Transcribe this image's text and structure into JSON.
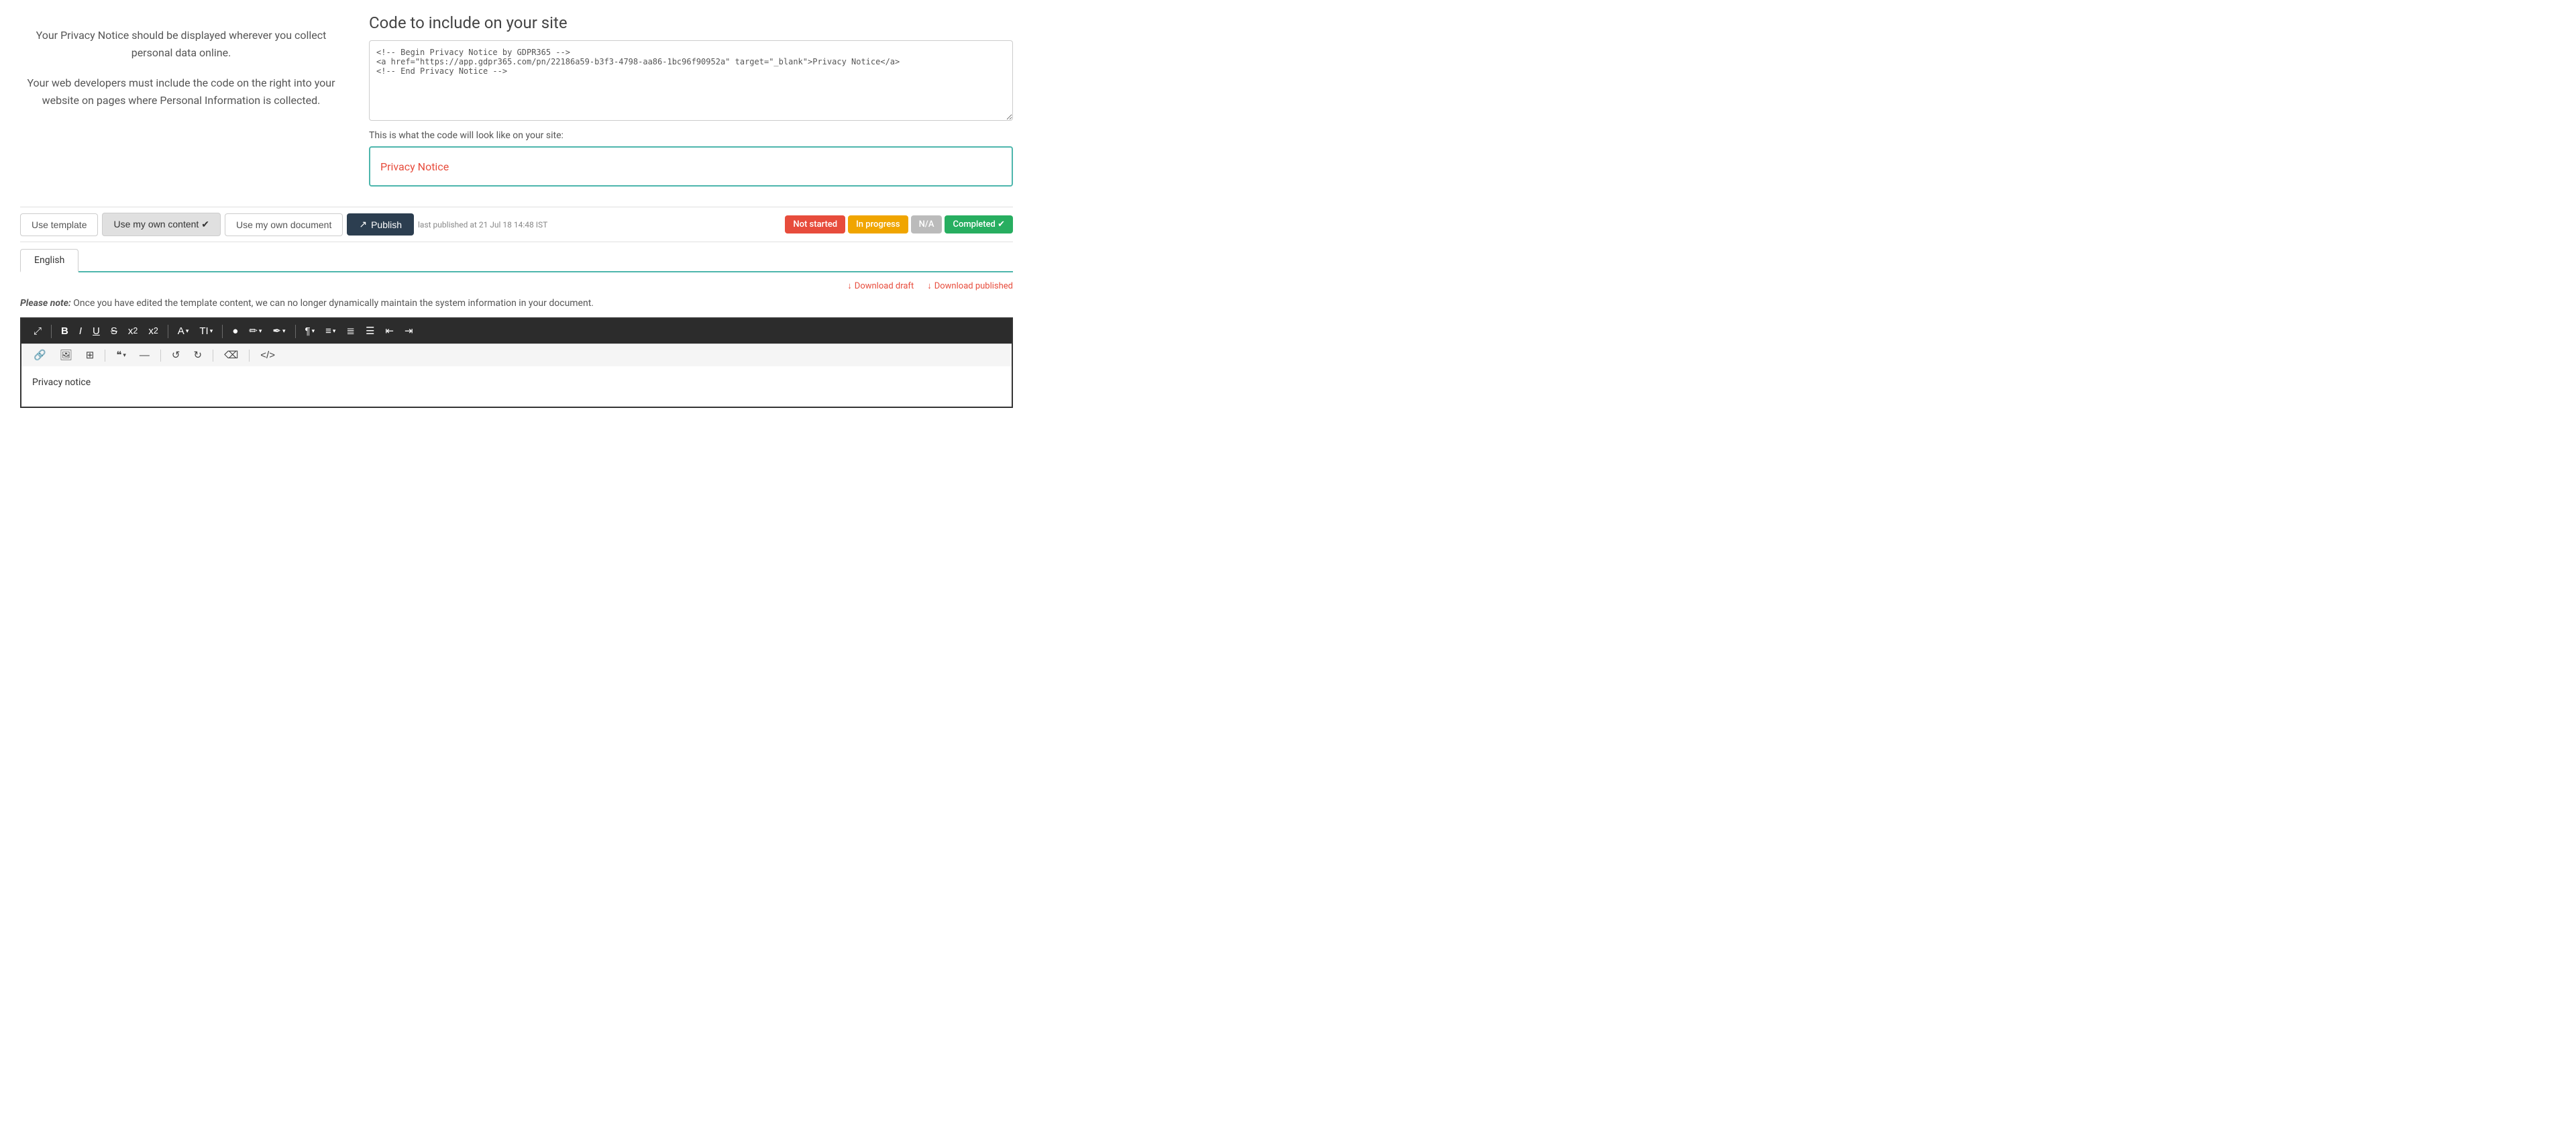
{
  "header": {
    "code_section_title": "Code to include on your site",
    "code_value": "<!-- Begin Privacy Notice by GDPR365 -->\n<a href=\"https://app.gdpr365.com/pn/22186a59-b3f3-4798-aa86-1bc96f90952a\" target=\"_blank\">Privacy Notice</a>\n<!-- End Privacy Notice -->",
    "preview_label": "This is what the code will look like on your site:",
    "preview_link_text": "Privacy Notice"
  },
  "left_panel": {
    "paragraph1": "Your Privacy Notice should be displayed wherever you collect personal data online.",
    "paragraph2": "Your web developers must include the code on the right into your website on pages where Personal Information is collected."
  },
  "toolbar": {
    "use_template_label": "Use template",
    "use_own_content_label": "Use my own content ✔",
    "use_own_document_label": "Use my own document",
    "publish_label": "Publish",
    "publish_time": "last published at 21 Jul 18 14:48 IST",
    "badges": {
      "not_started": "Not started",
      "in_progress": "In progress",
      "na": "N/A",
      "completed": "Completed ✔"
    }
  },
  "language_tabs": {
    "tabs": [
      {
        "label": "English",
        "active": true
      }
    ]
  },
  "downloads": {
    "draft_label": "Download draft",
    "published_label": "Download published"
  },
  "notice": {
    "text_html": "<b>Please note:</b> Once you have edited the template content, we can no longer dynamically maintain the system information in your document."
  },
  "editor": {
    "content": "Privacy notice",
    "toolbar": {
      "expand": "⤢",
      "bold": "B",
      "italic": "I",
      "underline": "U",
      "strikethrough": "S",
      "subscript": "x₂",
      "superscript": "x²",
      "font_color": "A",
      "font_size": "TI",
      "highlight": "●",
      "pen": "✏",
      "pen2": "✒",
      "paragraph": "¶",
      "align": "≡",
      "ordered_list": "≣",
      "unordered_list": "☰",
      "indent_left": "⇤",
      "indent_right": "⇥",
      "row2": {
        "link": "🔗",
        "image": "🖼",
        "table": "⊞",
        "quote": "❝",
        "hr": "—",
        "undo": "↺",
        "redo": "↻",
        "eraser": "⌫",
        "code": "</>",
        "more": "▾"
      }
    }
  }
}
